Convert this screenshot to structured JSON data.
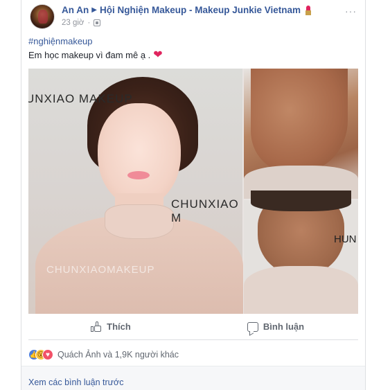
{
  "post": {
    "author": "An An",
    "group": "Hội Nghiện Makeup - Makeup Junkie Vietnam",
    "time": "23 giờ",
    "hashtag": "#nghiệnmakeup",
    "caption": "Em học makeup vì đam mê ạ .",
    "caption_emoji": "❤",
    "more_menu": "···"
  },
  "media": {
    "main_sign_text": "UNXIAO MAKEUP",
    "main_sign_text2": "CHUNXIAO M",
    "main_watermark": "CHUNXIAOMAKEUP",
    "right_text": "HUN"
  },
  "actions": {
    "like_label": "Thích",
    "comment_label": "Bình luận"
  },
  "reactions": {
    "summary": "Quách Ảnh và 1,9K người khác"
  },
  "comments": {
    "view_previous": "Xem các bình luận trước"
  },
  "icons": [
    "lipstick-icon",
    "globe-icon",
    "like-thumb-icon",
    "comment-icon",
    "like-reaction-icon",
    "wow-reaction-icon",
    "love-reaction-icon",
    "heart-icon"
  ],
  "colors": {
    "link_blue": "#365899",
    "meta_gray": "#90949c",
    "action_gray": "#616770",
    "heart_red": "#e0245e"
  }
}
